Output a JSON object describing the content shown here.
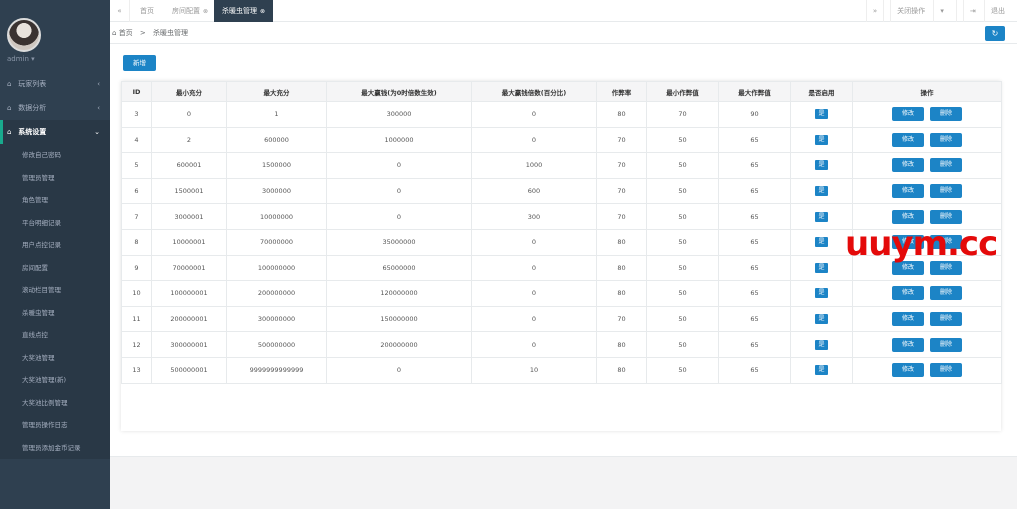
{
  "sidebar": {
    "profile_name": "admin",
    "menus": [
      {
        "label": "玩家列表"
      },
      {
        "label": "数据分析"
      },
      {
        "label": "系统设置"
      }
    ],
    "sub_items": [
      {
        "label": "修改自己密码"
      },
      {
        "label": "管理员管理"
      },
      {
        "label": "角色管理"
      },
      {
        "label": "平台明细记录"
      },
      {
        "label": "用户点控记录"
      },
      {
        "label": "房间配置"
      },
      {
        "label": "滚动栏目管理"
      },
      {
        "label": "杀暖虫管理"
      },
      {
        "label": "直线点控"
      },
      {
        "label": "大奖池管理"
      },
      {
        "label": "大奖池管理(新)"
      },
      {
        "label": "大奖池比例管理"
      },
      {
        "label": "管理员操作日志"
      },
      {
        "label": "管理员添加金币记录"
      }
    ]
  },
  "tabs": [
    {
      "label": "首页"
    },
    {
      "label": "房间配置"
    },
    {
      "label": "杀暖虫管理"
    }
  ],
  "topbar": {
    "close_ops": "关闭操作",
    "logout": "退出"
  },
  "breadcrumb": {
    "home": "首页",
    "current": "杀暖虫管理"
  },
  "toolbar": {
    "add_label": "新增"
  },
  "table": {
    "headers": [
      "ID",
      "最小充分",
      "最大充分",
      "最大赢钱(为0时倍数生效)",
      "最大赢钱倍数(百分比)",
      "作弊率",
      "最小作弊值",
      "最大作弊值",
      "是否启用",
      "操作"
    ],
    "enabled_label": "是",
    "edit_label": "修改",
    "delete_label": "删除",
    "rows": [
      [
        "3",
        "0",
        "1",
        "300000",
        "0",
        "80",
        "70",
        "90"
      ],
      [
        "4",
        "2",
        "600000",
        "1000000",
        "0",
        "70",
        "50",
        "65"
      ],
      [
        "5",
        "600001",
        "1500000",
        "0",
        "1000",
        "70",
        "50",
        "65"
      ],
      [
        "6",
        "1500001",
        "3000000",
        "0",
        "600",
        "70",
        "50",
        "65"
      ],
      [
        "7",
        "3000001",
        "10000000",
        "0",
        "300",
        "70",
        "50",
        "65"
      ],
      [
        "8",
        "10000001",
        "70000000",
        "35000000",
        "0",
        "80",
        "50",
        "65"
      ],
      [
        "9",
        "70000001",
        "100000000",
        "65000000",
        "0",
        "80",
        "50",
        "65"
      ],
      [
        "10",
        "100000001",
        "200000000",
        "120000000",
        "0",
        "80",
        "50",
        "65"
      ],
      [
        "11",
        "200000001",
        "300000000",
        "150000000",
        "0",
        "70",
        "50",
        "65"
      ],
      [
        "12",
        "300000001",
        "500000000",
        "200000000",
        "0",
        "80",
        "50",
        "65"
      ],
      [
        "13",
        "500000001",
        "9999999999999",
        "0",
        "10",
        "80",
        "50",
        "65"
      ]
    ]
  },
  "watermark": "uuym.cc",
  "colors": {
    "sidebar": "#2f4050",
    "primary": "#1c84c6",
    "watermark": "#e40a0a"
  }
}
